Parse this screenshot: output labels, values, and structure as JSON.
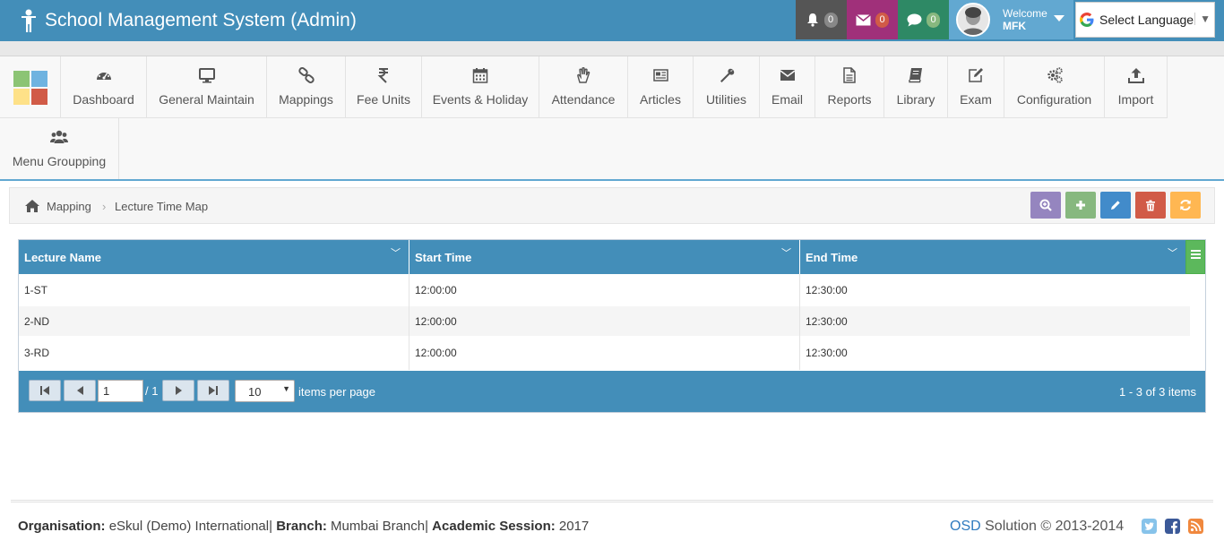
{
  "header": {
    "title": "School Management System (Admin)",
    "notifications": {
      "count": "0"
    },
    "messages": {
      "count": "0"
    },
    "chats": {
      "count": "0"
    },
    "user": {
      "welcome": "Welcome",
      "name": "MFK"
    },
    "language": {
      "label": "Select Language"
    }
  },
  "menu": {
    "items": [
      {
        "label": "Dashboard",
        "icon": "dashboard-icon"
      },
      {
        "label": "General Maintain",
        "icon": "desktop-icon"
      },
      {
        "label": "Mappings",
        "icon": "link-icon"
      },
      {
        "label": "Fee Units",
        "icon": "rupee-icon"
      },
      {
        "label": "Events & Holiday",
        "icon": "calendar-icon"
      },
      {
        "label": "Attendance",
        "icon": "hand-icon"
      },
      {
        "label": "Articles",
        "icon": "newspaper-icon"
      },
      {
        "label": "Utilities",
        "icon": "wrench-icon"
      },
      {
        "label": "Email",
        "icon": "envelope-icon"
      },
      {
        "label": "Reports",
        "icon": "file-icon"
      },
      {
        "label": "Library",
        "icon": "book-icon"
      },
      {
        "label": "Exam",
        "icon": "edit-icon"
      },
      {
        "label": "Configuration",
        "icon": "gears-icon"
      },
      {
        "label": "Import",
        "icon": "upload-icon"
      },
      {
        "label": "Menu Groupping",
        "icon": "users-icon"
      }
    ]
  },
  "breadcrumb": {
    "parent": "Mapping",
    "current": "Lecture Time Map"
  },
  "grid": {
    "columns": [
      "Lecture Name",
      "Start Time",
      "End Time"
    ],
    "rows": [
      [
        "1-ST",
        "12:00:00",
        "12:30:00"
      ],
      [
        "2-ND",
        "12:00:00",
        "12:30:00"
      ],
      [
        "3-RD",
        "12:00:00",
        "12:30:00"
      ]
    ],
    "pager": {
      "page": "1",
      "of": "/ 1",
      "page_size": "10",
      "items_per_page": "items per page",
      "info": "1 - 3 of 3 items"
    }
  },
  "footer": {
    "organisation_label": "Organisation:",
    "organisation": "eSkul (Demo) International",
    "branch_label": "Branch:",
    "branch": "Mumbai Branch",
    "session_label": "Academic Session:",
    "session": "2017",
    "brand": "OSD",
    "copyright": "Solution © 2013-2014"
  },
  "colors": {
    "primary": "#438eb9",
    "search_button": "#9585bf",
    "add_button": "#87b87f",
    "edit_button": "#428bca",
    "delete_button": "#d15b47",
    "refresh_button": "#ffb752"
  }
}
